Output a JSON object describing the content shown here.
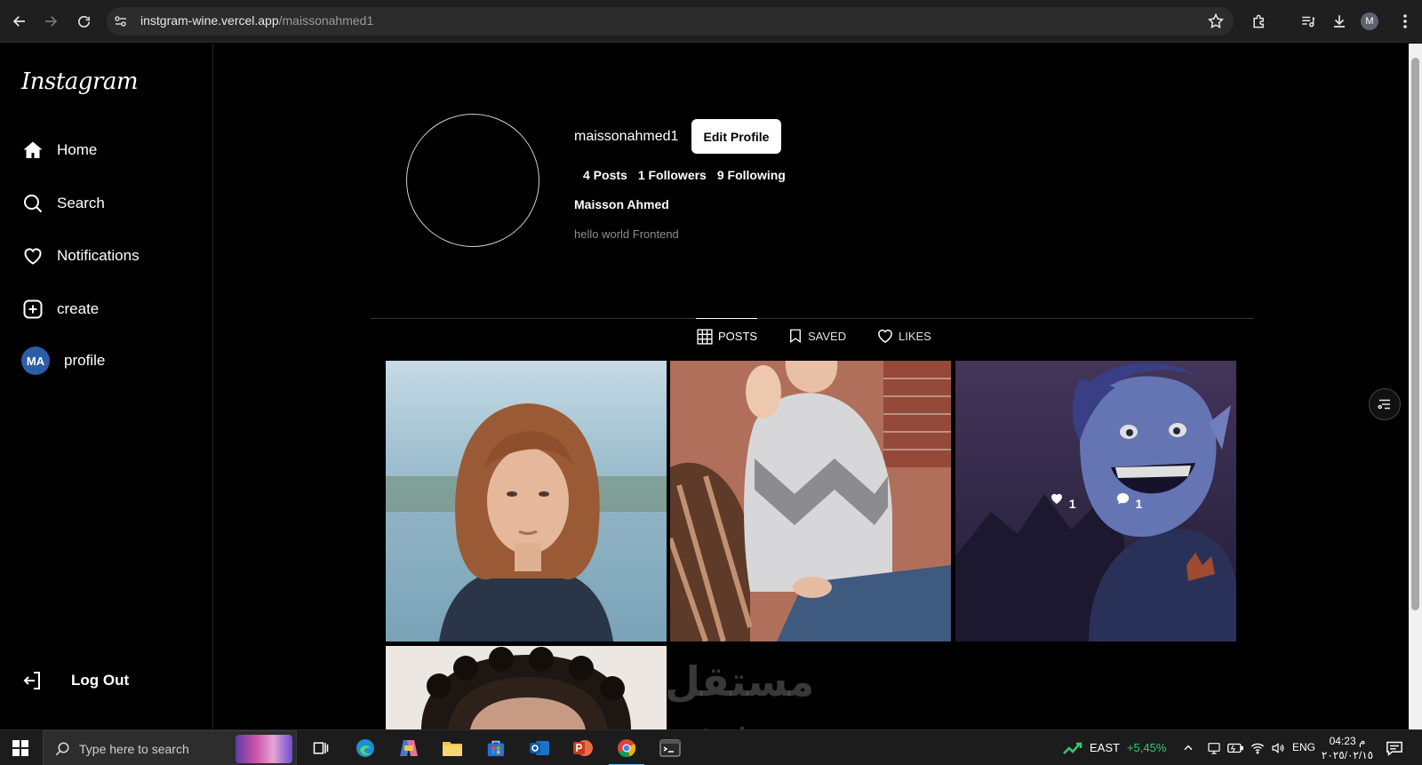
{
  "browser": {
    "url_host": "instgram-wine.vercel.app",
    "url_path": "/maissonahmed1",
    "profile_initial": "M"
  },
  "sidebar": {
    "logo": "Instagram",
    "items": [
      {
        "label": "Home",
        "icon": "home-icon"
      },
      {
        "label": "Search",
        "icon": "search-icon"
      },
      {
        "label": "Notifications",
        "icon": "heart-icon"
      },
      {
        "label": "create",
        "icon": "plus-square-icon"
      },
      {
        "label": "profile",
        "icon": "avatar",
        "avatar_text": "MA"
      }
    ],
    "logout_label": "Log Out"
  },
  "profile": {
    "username": "maissonahmed1",
    "edit_label": "Edit Profile",
    "stats": {
      "posts": "4 Posts",
      "followers": "1 Followers",
      "following": "9 Following"
    },
    "full_name": "Maisson Ahmed",
    "bio": "hello world Frontend"
  },
  "tabs": [
    {
      "label": "POSTS",
      "icon": "grid-icon",
      "active": true
    },
    {
      "label": "SAVED",
      "icon": "bookmark-icon",
      "active": false
    },
    {
      "label": "LIKES",
      "icon": "heart-icon",
      "active": false
    }
  ],
  "posts": [
    {
      "id": "post-1",
      "alt": "red-haired woman portrait"
    },
    {
      "id": "post-2",
      "alt": "woman in grey sweater"
    },
    {
      "id": "post-3",
      "alt": "blue animated character",
      "likes": "1",
      "comments": "1"
    },
    {
      "id": "post-4",
      "alt": "woman with curly hair"
    }
  ],
  "watermark": {
    "arabic": "مستقل",
    "latin": "mostaql.com"
  },
  "taskbar": {
    "search_placeholder": "Type here to search",
    "stock_symbol": "EAST",
    "stock_change": "+5,45%",
    "language": "ENG",
    "time": "04:23 م",
    "date": "٢٠٢٥/٠٢/١٥"
  },
  "colors": {
    "background": "#000000",
    "avatar_blue": "#2e5da8",
    "muted_text": "#8e8e8e",
    "stock_green": "#37c871"
  }
}
